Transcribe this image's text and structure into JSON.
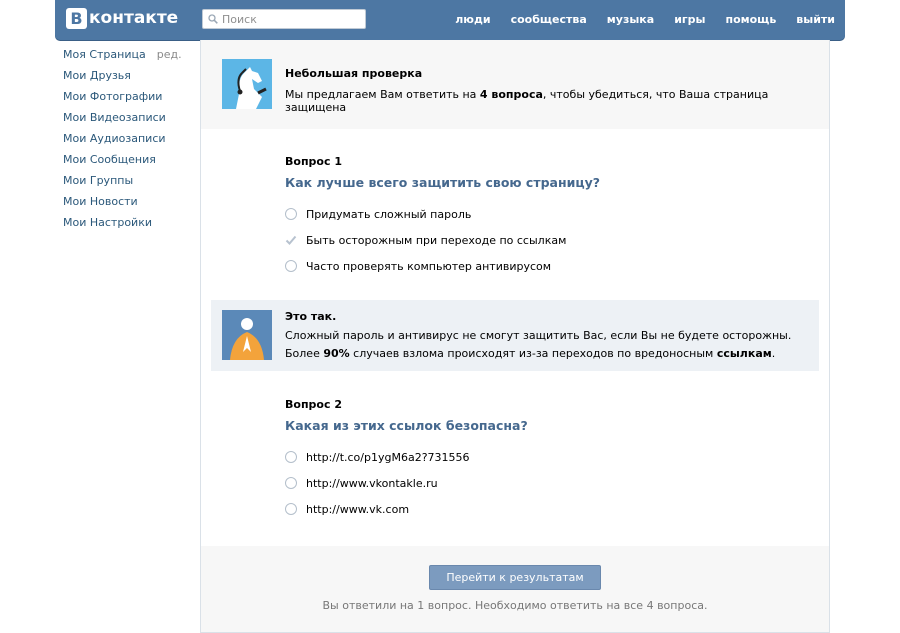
{
  "header": {
    "logo_letter": "В",
    "logo_text": "контакте",
    "search_placeholder": "Поиск",
    "nav": [
      "люди",
      "сообщества",
      "музыка",
      "игры",
      "помощь",
      "выйти"
    ]
  },
  "sidebar": {
    "items": [
      {
        "label": "Моя Страница",
        "extra": "ред."
      },
      {
        "label": "Мои Друзья"
      },
      {
        "label": "Мои Фотографии"
      },
      {
        "label": "Мои Видеозаписи"
      },
      {
        "label": "Мои Аудиозаписи"
      },
      {
        "label": "Мои Сообщения"
      },
      {
        "label": "Мои Группы"
      },
      {
        "label": "Мои Новости"
      },
      {
        "label": "Мои Настройки"
      }
    ]
  },
  "intro": {
    "title": "Небольшая проверка",
    "text_before": "Мы предлагаем Вам ответить на ",
    "text_bold": "4 вопроса",
    "text_after": ", чтобы убедиться, что Ваша страница защищена"
  },
  "question1": {
    "label": "Вопрос 1",
    "text": "Как лучше всего защитить свою страницу?",
    "options": [
      {
        "label": "Придумать сложный пароль",
        "state": "empty"
      },
      {
        "label": "Быть осторожным при переходе по ссылкам",
        "state": "checked"
      },
      {
        "label": "Часто проверять компьютер антивирусом",
        "state": "empty"
      }
    ]
  },
  "answer": {
    "title": "Это так.",
    "line1": "Сложный пароль и антивирус не смогут защитить Вас, если Вы не будете осторожны.",
    "line2_a": "Более ",
    "line2_b": "90%",
    "line2_c": " случаев взлома происходят из-за переходов по вредоносным ",
    "line2_d": "ссылкам",
    "line2_e": "."
  },
  "question2": {
    "label": "Вопрос 2",
    "text": "Какая из этих ссылок безопасна?",
    "options": [
      {
        "label": "http://t.co/p1ygM6a2?731556"
      },
      {
        "label": "http://www.vkontakle.ru"
      },
      {
        "label": "http://www.vk.com"
      }
    ]
  },
  "footer": {
    "button": "Перейти к результатам",
    "status": "Вы ответили на 1 вопрос. Необходимо ответить на все 4 вопроса."
  },
  "colors": {
    "header": "#4d77a3",
    "link": "#2b587a",
    "question": "#45688e",
    "button": "#7c9bbf"
  }
}
